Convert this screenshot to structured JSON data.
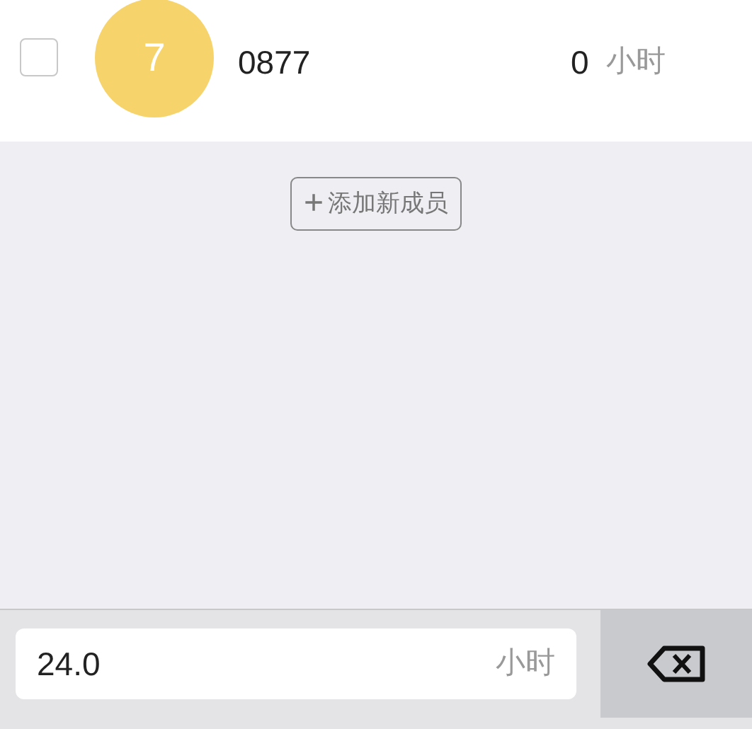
{
  "member": {
    "checked": false,
    "avatar_text": "7",
    "name": "0877",
    "hours": "0",
    "unit": "小时"
  },
  "add_button": {
    "icon": "+",
    "label": "添加新成员"
  },
  "input": {
    "value": "24.0",
    "unit": "小时"
  }
}
